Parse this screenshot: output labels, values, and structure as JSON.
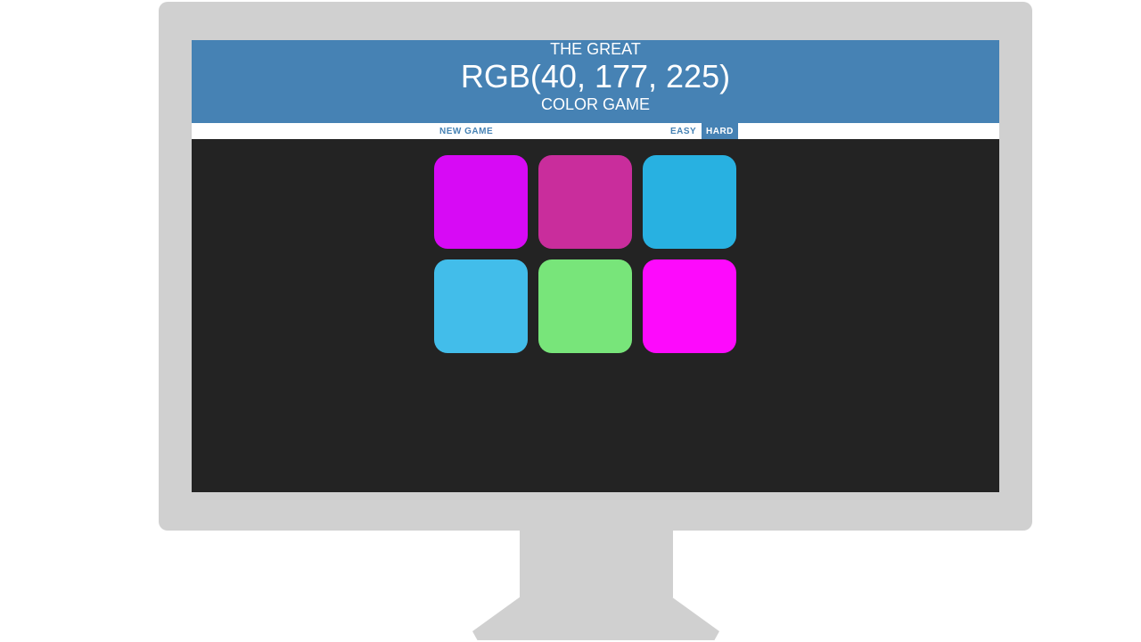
{
  "header": {
    "line1": "THE GREAT",
    "rgb_display": "RGB(40, 177, 225)",
    "line3": "COLOR GAME"
  },
  "stripe": {
    "new_game_label": "NEW GAME",
    "easy_label": "EASY",
    "hard_label": "HARD",
    "selected_mode": "HARD"
  },
  "squares": [
    {
      "color": "#d70af5"
    },
    {
      "color": "#c92d9c"
    },
    {
      "color": "#28b1e1"
    },
    {
      "color": "#42bdea"
    },
    {
      "color": "#78e57a"
    },
    {
      "color": "#fd0afc"
    }
  ],
  "colors": {
    "header_bg": "#4682b4",
    "screen_bg": "#232323",
    "monitor": "#d0d0d0"
  }
}
